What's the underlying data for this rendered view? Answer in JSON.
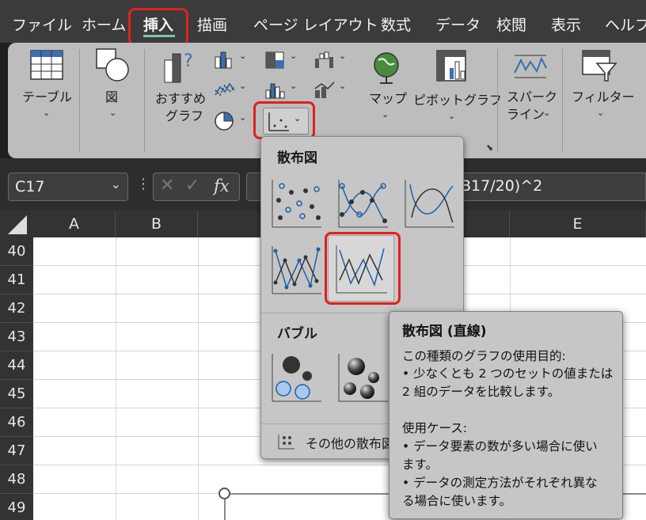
{
  "menu": {
    "tabs": [
      {
        "label": "ファイル"
      },
      {
        "label": "ホーム"
      },
      {
        "label": "挿入"
      },
      {
        "label": "描画"
      },
      {
        "label": "ページ レイアウト"
      },
      {
        "label": "数式"
      },
      {
        "label": "データ"
      },
      {
        "label": "校閲"
      },
      {
        "label": "表示"
      },
      {
        "label": "ヘルプ"
      }
    ],
    "active_tab": "挿入"
  },
  "ribbon": {
    "table_label": "テーブル",
    "figure_label": "図",
    "recommended_label_1": "おすすめ",
    "recommended_label_2": "グラフ",
    "map_label": "マップ",
    "pivot_label": "ピボットグラフ",
    "sparkline_label_1": "スパーク",
    "sparkline_label_2": "ライン",
    "filter_label": "フィルター"
  },
  "formula_bar": {
    "name_box": "C17",
    "fx_label": "fx",
    "formula_visible": "B17/20)^2"
  },
  "grid": {
    "columns": [
      "A",
      "B",
      "E"
    ],
    "rows": [
      "40",
      "41",
      "42",
      "43",
      "44",
      "45",
      "46",
      "47",
      "48",
      "49"
    ]
  },
  "dropdown": {
    "scatter_title": "散布図",
    "bubble_title": "バブル",
    "more_label": "その他の散布図"
  },
  "tooltip": {
    "title": "散布図 (直線)",
    "purpose_heading": "この種類のグラフの使用目的:",
    "purpose_line_1": "• 少なくとも 2 つのセットの値または",
    "purpose_line_2": "2 組のデータを比較します。",
    "usage_heading": "使用ケース:",
    "usage_line_1": "• データ要素の数が多い場合に使い",
    "usage_line_2": "ます。",
    "usage_line_3": "• データの測定方法がそれぞれ異な",
    "usage_line_4": "る場合に使います。"
  },
  "colors": {
    "highlight_red": "#e02020",
    "active_underline": "#7fc6a4",
    "chart_blue": "#1f5fa8"
  }
}
